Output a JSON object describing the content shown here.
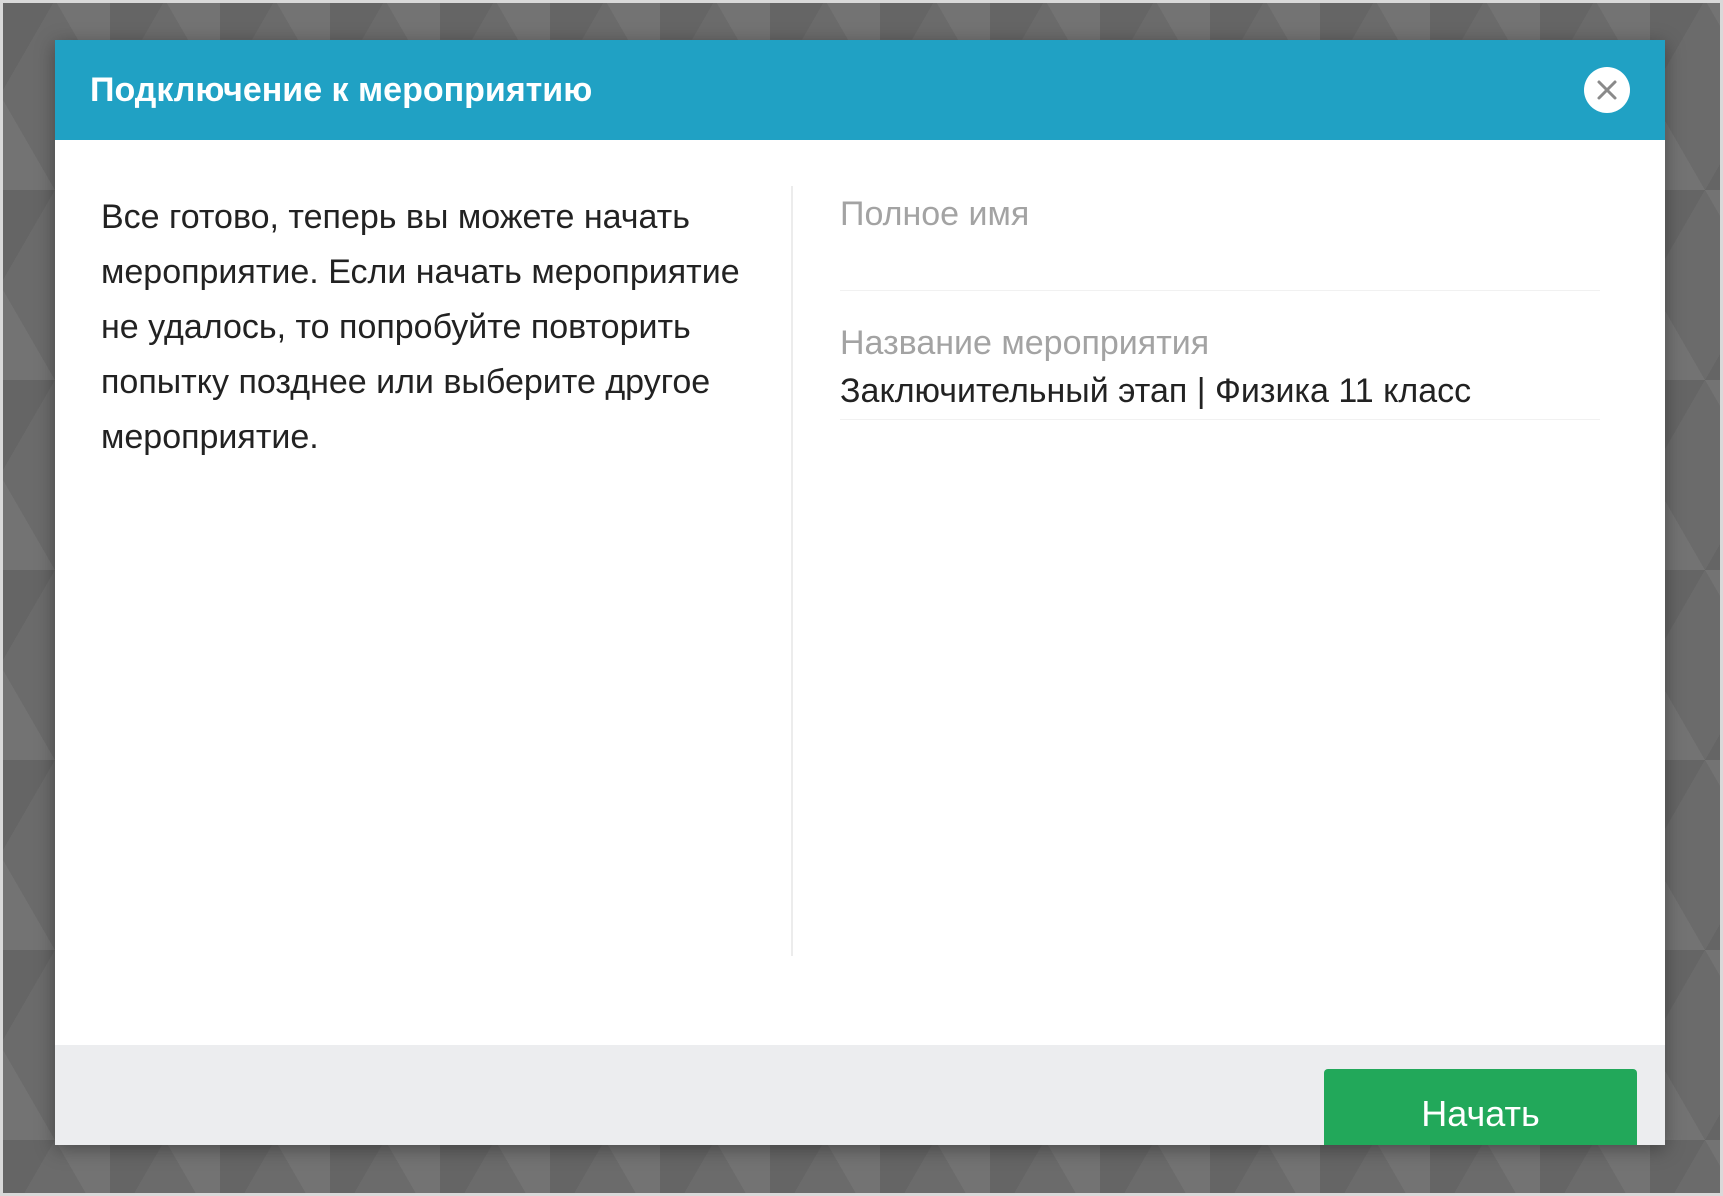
{
  "dialog": {
    "title": "Подключение к мероприятию",
    "close_icon": "close-icon",
    "message": "Все готово, теперь вы можете начать мероприятие. Если начать мероприятие не удалось, то попробуйте повторить попытку позднее или выберите другое мероприятие.",
    "fields": {
      "full_name": {
        "label": "Полное имя",
        "value": ""
      },
      "event_name": {
        "label": "Название мероприятия",
        "value": "Заключительный этап | Физика 11 класс"
      }
    },
    "start_button_label": "Начать"
  },
  "colors": {
    "header": "#20a1c4",
    "start_button": "#22a85a",
    "footer": "#ecedef",
    "label": "#a3a3a3",
    "text": "#222222"
  }
}
